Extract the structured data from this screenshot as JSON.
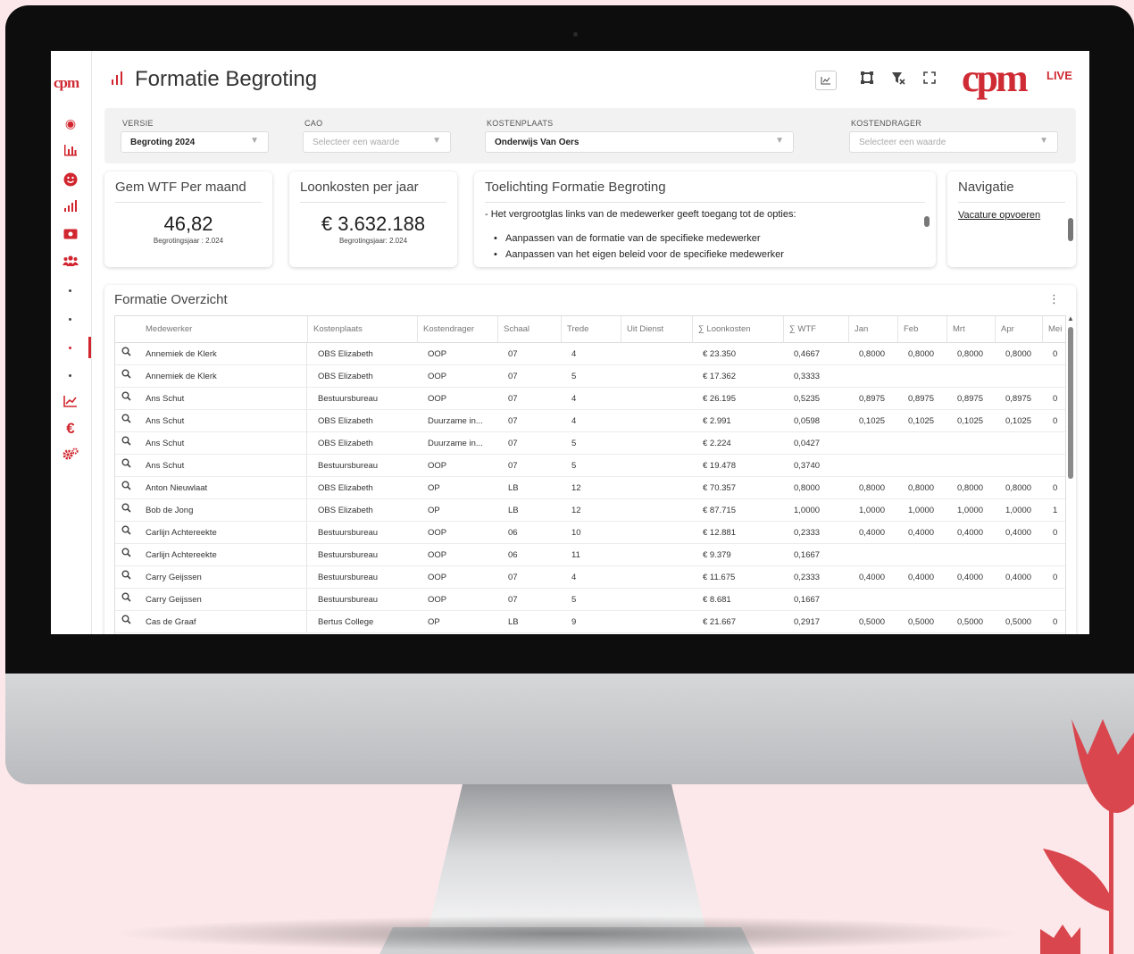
{
  "app": {
    "title": "Formatie Begroting",
    "sidebar_logo": "cpm",
    "brand_logo": "cpm",
    "brand_suffix": "LIVE"
  },
  "filters": [
    {
      "label": "VERSIE",
      "value": "Begroting 2024",
      "placeholder": false
    },
    {
      "label": "CAO",
      "value": "Selecteer een waarde",
      "placeholder": true
    },
    {
      "label": "KOSTENPLAATS",
      "value": "Onderwijs Van Oers",
      "placeholder": false
    },
    {
      "label": "KOSTENDRAGER",
      "value": "Selecteer een waarde",
      "placeholder": true
    }
  ],
  "kpis": {
    "wtf": {
      "title": "Gem WTF Per maand",
      "value": "46,82",
      "sub": "Begrotingsjaar : 2.024"
    },
    "loonkosten": {
      "title": "Loonkosten per jaar",
      "value": "€ 3.632.188",
      "sub": "Begrotingsjaar: 2.024"
    }
  },
  "info": {
    "title": "Toelichting Formatie Begroting",
    "line": "- Het vergrootglas links van de medewerker geeft toegang tot de opties:",
    "bullets": [
      "Aanpassen van de formatie van de specifieke medewerker",
      "Aanpassen van het eigen beleid voor de specifieke medewerker"
    ]
  },
  "navigation": {
    "title": "Navigatie",
    "link": "Vacature opvoeren"
  },
  "table": {
    "title": "Formatie Overzicht",
    "columns": [
      "Medewerker",
      "Kostenplaats",
      "Kostendrager",
      "Schaal",
      "Trede",
      "Uit Dienst",
      "∑ Loonkosten",
      "∑ WTF",
      "Jan",
      "Feb",
      "Mrt",
      "Apr",
      "Mei"
    ],
    "rows": [
      [
        "Annemiek de Klerk",
        "OBS Elizabeth",
        "OOP",
        "07",
        "4",
        "",
        "€ 23.350",
        "0,4667",
        "0,8000",
        "0,8000",
        "0,8000",
        "0,8000",
        "0"
      ],
      [
        "Annemiek de Klerk",
        "OBS Elizabeth",
        "OOP",
        "07",
        "5",
        "",
        "€ 17.362",
        "0,3333",
        "",
        "",
        "",
        "",
        ""
      ],
      [
        "Ans Schut",
        "Bestuursbureau",
        "OOP",
        "07",
        "4",
        "",
        "€ 26.195",
        "0,5235",
        "0,8975",
        "0,8975",
        "0,8975",
        "0,8975",
        "0"
      ],
      [
        "Ans Schut",
        "OBS Elizabeth",
        "Duurzame in...",
        "07",
        "4",
        "",
        "€ 2.991",
        "0,0598",
        "0,1025",
        "0,1025",
        "0,1025",
        "0,1025",
        "0"
      ],
      [
        "Ans Schut",
        "OBS Elizabeth",
        "Duurzame in...",
        "07",
        "5",
        "",
        "€ 2.224",
        "0,0427",
        "",
        "",
        "",
        "",
        ""
      ],
      [
        "Ans Schut",
        "Bestuursbureau",
        "OOP",
        "07",
        "5",
        "",
        "€ 19.478",
        "0,3740",
        "",
        "",
        "",
        "",
        ""
      ],
      [
        "Anton Nieuwlaat",
        "OBS Elizabeth",
        "OP",
        "LB",
        "12",
        "",
        "€ 70.357",
        "0,8000",
        "0,8000",
        "0,8000",
        "0,8000",
        "0,8000",
        "0"
      ],
      [
        "Bob de Jong",
        "OBS Elizabeth",
        "OP",
        "LB",
        "12",
        "",
        "€ 87.715",
        "1,0000",
        "1,0000",
        "1,0000",
        "1,0000",
        "1,0000",
        "1"
      ],
      [
        "Carlijn Achtereekte",
        "Bestuursbureau",
        "OOP",
        "06",
        "10",
        "",
        "€ 12.881",
        "0,2333",
        "0,4000",
        "0,4000",
        "0,4000",
        "0,4000",
        "0"
      ],
      [
        "Carlijn Achtereekte",
        "Bestuursbureau",
        "OOP",
        "06",
        "11",
        "",
        "€ 9.379",
        "0,1667",
        "",
        "",
        "",
        "",
        ""
      ],
      [
        "Carry Geijssen",
        "Bestuursbureau",
        "OOP",
        "07",
        "4",
        "",
        "€ 11.675",
        "0,2333",
        "0,4000",
        "0,4000",
        "0,4000",
        "0,4000",
        "0"
      ],
      [
        "Carry Geijssen",
        "Bestuursbureau",
        "OOP",
        "07",
        "5",
        "",
        "€ 8.681",
        "0,1667",
        "",
        "",
        "",
        "",
        ""
      ],
      [
        "Cas de Graaf",
        "Bertus College",
        "OP",
        "LB",
        "9",
        "",
        "€ 21.667",
        "0,2917",
        "0,5000",
        "0,5000",
        "0,5000",
        "0,5000",
        "0"
      ]
    ]
  },
  "colors": {
    "accent": "#d1262f",
    "background": "#fce8ea"
  }
}
